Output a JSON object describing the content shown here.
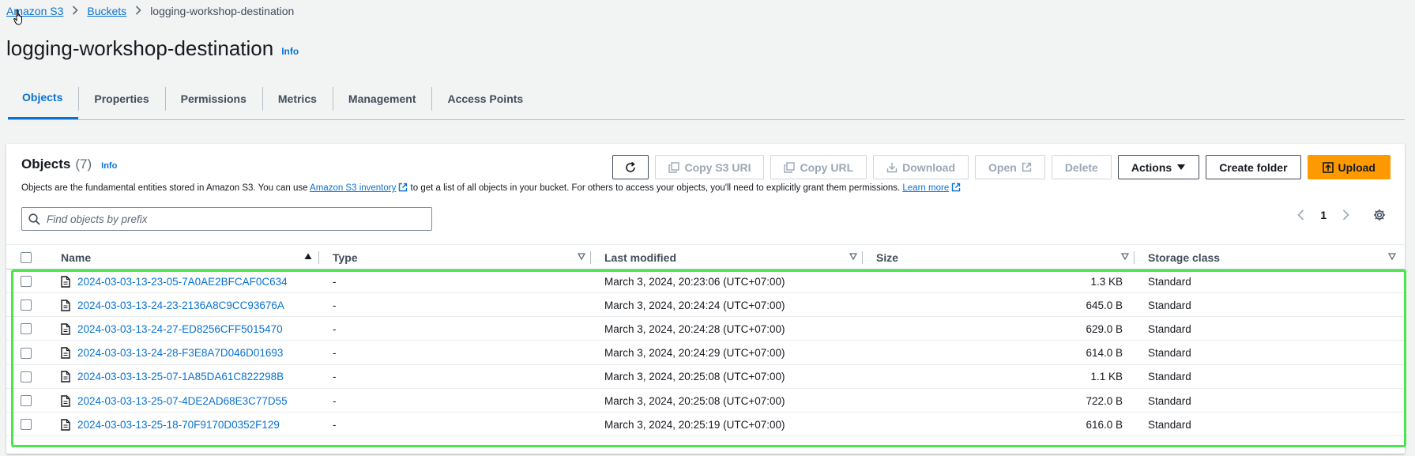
{
  "breadcrumb": {
    "items": [
      {
        "label": "Amazon S3"
      },
      {
        "label": "Buckets"
      },
      {
        "label": "logging-workshop-destination"
      }
    ]
  },
  "page": {
    "title": "logging-workshop-destination",
    "info_label": "Info"
  },
  "tabs": [
    {
      "label": "Objects",
      "active": true
    },
    {
      "label": "Properties"
    },
    {
      "label": "Permissions"
    },
    {
      "label": "Metrics"
    },
    {
      "label": "Management"
    },
    {
      "label": "Access Points"
    }
  ],
  "objects_panel": {
    "heading": "Objects",
    "count": "(7)",
    "info_label": "Info",
    "description": {
      "part1": "Objects are the fundamental entities stored in Amazon S3. You can use ",
      "inventory_link": "Amazon S3 inventory",
      "part2": " to get a list of all objects in your bucket. For others to access your objects, you'll need to explicitly grant them permissions. ",
      "learn_more": "Learn more"
    },
    "toolbar": {
      "copy_uri": "Copy S3 URI",
      "copy_url": "Copy URL",
      "download": "Download",
      "open": "Open",
      "delete": "Delete",
      "actions": "Actions",
      "create_folder": "Create folder",
      "upload": "Upload"
    },
    "search": {
      "placeholder": "Find objects by prefix",
      "value": ""
    },
    "pagination": {
      "current_page": "1"
    },
    "table": {
      "columns": {
        "name": "Name",
        "type": "Type",
        "last_modified": "Last modified",
        "size": "Size",
        "storage_class": "Storage class"
      },
      "rows": [
        {
          "name": "2024-03-03-13-23-05-7A0AE2BFCAF0C634",
          "type": "-",
          "last_modified": "March 3, 2024, 20:23:06 (UTC+07:00)",
          "size": "1.3 KB",
          "storage_class": "Standard"
        },
        {
          "name": "2024-03-03-13-24-23-2136A8C9CC93676A",
          "type": "-",
          "last_modified": "March 3, 2024, 20:24:24 (UTC+07:00)",
          "size": "645.0 B",
          "storage_class": "Standard"
        },
        {
          "name": "2024-03-03-13-24-27-ED8256CFF5015470",
          "type": "-",
          "last_modified": "March 3, 2024, 20:24:28 (UTC+07:00)",
          "size": "629.0 B",
          "storage_class": "Standard"
        },
        {
          "name": "2024-03-03-13-24-28-F3E8A7D046D01693",
          "type": "-",
          "last_modified": "March 3, 2024, 20:24:29 (UTC+07:00)",
          "size": "614.0 B",
          "storage_class": "Standard"
        },
        {
          "name": "2024-03-03-13-25-07-1A85DA61C822298B",
          "type": "-",
          "last_modified": "March 3, 2024, 20:25:08 (UTC+07:00)",
          "size": "1.1 KB",
          "storage_class": "Standard"
        },
        {
          "name": "2024-03-03-13-25-07-4DE2AD68E3C77D55",
          "type": "-",
          "last_modified": "March 3, 2024, 20:25:08 (UTC+07:00)",
          "size": "722.0 B",
          "storage_class": "Standard"
        },
        {
          "name": "2024-03-03-13-25-18-70F9170D0352F129",
          "type": "-",
          "last_modified": "March 3, 2024, 20:25:19 (UTC+07:00)",
          "size": "616.0 B",
          "storage_class": "Standard"
        }
      ]
    }
  },
  "colors": {
    "link": "#0972d3",
    "primary_button": "#ff9900",
    "highlight": "#4be54b"
  }
}
